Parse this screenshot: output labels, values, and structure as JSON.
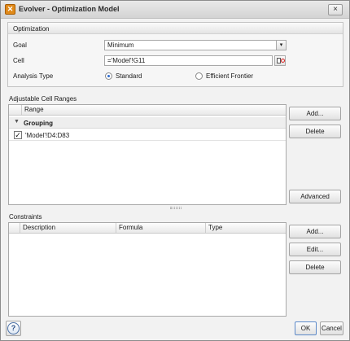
{
  "window": {
    "title": "Evolver - Optimization Model",
    "app_icon": "evolver-logo-icon",
    "close_label": "×"
  },
  "optimization": {
    "header": "Optimization",
    "goal_label": "Goal",
    "goal_value": "Minimum",
    "cell_label": "Cell",
    "cell_value": "='Model'!G11",
    "analysis_label": "Analysis Type",
    "analysis_options": [
      {
        "label": "Standard",
        "selected": true
      },
      {
        "label": "Efficient Frontier",
        "selected": false
      }
    ]
  },
  "adjustable": {
    "label": "Adjustable Cell Ranges",
    "column_header": "Range",
    "group_name": "Grouping",
    "rows": [
      {
        "checked": true,
        "check_glyph": "✓",
        "range": "'Model'!D4:D83"
      }
    ],
    "buttons": {
      "add": "Add...",
      "delete": "Delete",
      "advanced": "Advanced"
    }
  },
  "constraints": {
    "label": "Constraints",
    "columns": [
      "Description",
      "Formula",
      "Type"
    ],
    "buttons": {
      "add": "Add...",
      "edit": "Edit...",
      "delete": "Delete"
    }
  },
  "footer": {
    "help_label": "?",
    "ok_label": "OK",
    "cancel_label": "Cancel"
  },
  "colors": {
    "accent": "#2d6ccf",
    "app_icon": "#e08a1a"
  }
}
